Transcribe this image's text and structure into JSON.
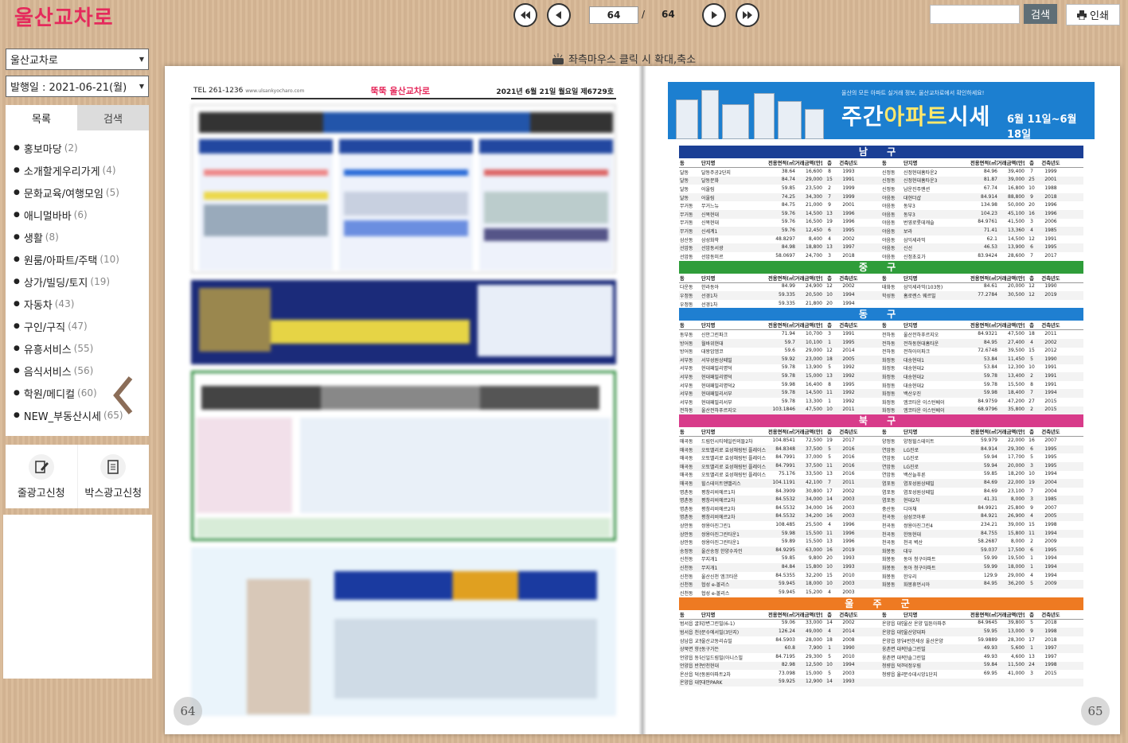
{
  "header": {
    "logo_part1": "울산",
    "logo_part2": "교차로",
    "current_page": "64",
    "page_separator": "/",
    "total_pages": "64",
    "search_placeholder": "",
    "search_label": "검색",
    "print_label": "인쇄"
  },
  "sidebar": {
    "publication_select": "울산교차로",
    "date_select": "발행일 : 2021-06-21(월)",
    "tabs": [
      "목록",
      "검색"
    ],
    "categories": [
      {
        "label": "홍보마당",
        "count": "(2)"
      },
      {
        "label": "소개할게우리가게",
        "count": "(4)"
      },
      {
        "label": "문화교육/여행모임",
        "count": "(5)"
      },
      {
        "label": "애니멀바바",
        "count": "(6)"
      },
      {
        "label": "생활",
        "count": "(8)"
      },
      {
        "label": "원룸/아파트/주택",
        "count": "(10)"
      },
      {
        "label": "상가/빌딩/토지",
        "count": "(19)"
      },
      {
        "label": "자동차",
        "count": "(43)"
      },
      {
        "label": "구인/구직",
        "count": "(47)"
      },
      {
        "label": "유흥서비스",
        "count": "(55)"
      },
      {
        "label": "음식서비스",
        "count": "(56)"
      },
      {
        "label": "학원/메디컬",
        "count": "(60)"
      },
      {
        "label": "NEW_부동산시세",
        "count": "(65)"
      }
    ],
    "ad_buttons": [
      "줄광고신청",
      "박스광고신청"
    ]
  },
  "viewer": {
    "hint": "좌측마우스 클릭 시 확대,축소",
    "left_page_number": "64",
    "right_page_number": "65",
    "left_page": {
      "tel": "TEL 261-1236",
      "site": "www.ulsankyocharo.com",
      "paper_name": "뚝뚝 울산교차로",
      "issue": "2021년 6월 21일 월요일 제6729호"
    },
    "right_page": {
      "banner_subtitle": "울산의 모든 아파트 실거래 정보, 울산교차로에서 확인하세요!",
      "banner_title_1": "주간",
      "banner_title_2": "아파트",
      "banner_title_3": "시세",
      "banner_dates": "6월 11일~6월 18일",
      "column_headers": [
        "동",
        "단지명",
        "전용면적(㎡)",
        "거래금액(만원)",
        "층",
        "건축년도"
      ],
      "sections": [
        {
          "name": "남 구",
          "color": "#1b3f95",
          "rows": [
            [
              "달동",
              "달동주공2단지",
              "38.64",
              "16,600",
              "8",
              "1993",
              "신정동",
              "신정현대홈타운2",
              "84.96",
              "39,400",
              "7",
              "1999"
            ],
            [
              "달동",
              "달동문화",
              "84.74",
              "29,000",
              "15",
              "1991",
              "신정동",
              "신정현대홈타운3",
              "81.87",
              "39,000",
              "25",
              "2001"
            ],
            [
              "달동",
              "어울림",
              "59.85",
              "23,500",
              "2",
              "1999",
              "신정동",
              "남운진주맨션",
              "67.74",
              "16,800",
              "10",
              "1988"
            ],
            [
              "달동",
              "어울림",
              "74.25",
              "34,300",
              "7",
              "1999",
              "야음동",
              "대현더샵",
              "84.914",
              "88,800",
              "9",
              "2018"
            ],
            [
              "무거동",
              "무거느뉴",
              "84.75",
              "21,000",
              "9",
              "2001",
              "야음동",
              "동부3",
              "134.98",
              "50,000",
              "20",
              "1996"
            ],
            [
              "무거동",
              "신복현대",
              "59.76",
              "14,500",
              "13",
              "1996",
              "야음동",
              "동부3",
              "104.23",
              "45,100",
              "16",
              "1996"
            ],
            [
              "무거동",
              "신복현대",
              "59.76",
              "16,500",
              "19",
              "1996",
              "야음동",
              "번영로롯데캐슬",
              "84.9761",
              "41,500",
              "3",
              "2006"
            ],
            [
              "무거동",
              "신세계1",
              "59.76",
              "12,450",
              "6",
              "1995",
              "야음동",
              "보라",
              "71.41",
              "13,360",
              "4",
              "1985"
            ],
            [
              "삼산동",
              "삼성화학",
              "48.8297",
              "8,400",
              "4",
              "2002",
              "야음동",
              "삼익세라믹",
              "62.1",
              "14,500",
              "12",
              "1991"
            ],
            [
              "선암동",
              "선암동서광",
              "84.98",
              "18,800",
              "13",
              "1997",
              "야음동",
              "신선",
              "46.53",
              "13,900",
              "6",
              "1995"
            ],
            [
              "선암동",
              "선암동미르",
              "58.0697",
              "24,700",
              "3",
              "2018",
              "야음동",
              "신정초호가",
              "83.9424",
              "28,600",
              "7",
              "2017"
            ]
          ]
        },
        {
          "name": "중 구",
          "color": "#2f9d3a",
          "rows": [
            [
              "다운동",
              "한라동아",
              "84.99",
              "24,900",
              "12",
              "2002",
              "태화동",
              "삼익세라믹(103동)",
              "84.61",
              "20,000",
              "12",
              "1990"
            ],
            [
              "우정동",
              "선경1차",
              "59.335",
              "20,500",
              "10",
              "1994",
              "학성동",
              "홈로렌스 웨르빌",
              "77.2784",
              "30,500",
              "12",
              "2019"
            ],
            [
              "우정동",
              "선경1차",
              "59.335",
              "21,800",
              "20",
              "1994",
              "",
              "",
              "",
              "",
              "",
              ""
            ]
          ]
        },
        {
          "name": "동 구",
          "color": "#1f7fd1",
          "rows": [
            [
              "동부동",
              "신안그린파크",
              "71.94",
              "10,700",
              "3",
              "1991",
              "전하동",
              "울산전하푸르지오",
              "84.9321",
              "47,500",
              "18",
              "2011"
            ],
            [
              "방어동",
              "월바위현대",
              "59.7",
              "10,100",
              "1",
              "1995",
              "전하동",
              "전하동현대홈타운",
              "84.95",
              "27,400",
              "4",
              "2002"
            ],
            [
              "방어동",
              "대왕암엠코",
              "59.6",
              "29,000",
              "12",
              "2014",
              "전하동",
              "전하아이파크",
              "72.6748",
              "39,500",
              "15",
              "2012"
            ],
            [
              "서부동",
              "서부성원상떼빌",
              "59.92",
              "23,000",
              "18",
              "2005",
              "화정동",
              "대송현대1",
              "53.84",
              "11,450",
              "5",
              "1990"
            ],
            [
              "서부동",
              "현대패밀리명덕",
              "59.78",
              "13,900",
              "5",
              "1992",
              "화정동",
              "대송현대2",
              "53.84",
              "12,300",
              "10",
              "1991"
            ],
            [
              "서부동",
              "현대패밀리명덕",
              "59.78",
              "15,000",
              "13",
              "1992",
              "화정동",
              "대송현대2",
              "59.78",
              "13,400",
              "2",
              "1991"
            ],
            [
              "서부동",
              "현대패밀리명덕2",
              "59.98",
              "16,400",
              "8",
              "1995",
              "화정동",
              "대송현대2",
              "59.78",
              "15,500",
              "8",
              "1991"
            ],
            [
              "서부동",
              "현대패밀리서부",
              "59.78",
              "14,500",
              "11",
              "1992",
              "화정동",
              "백산우진",
              "59.98",
              "18,400",
              "7",
              "1994"
            ],
            [
              "서부동",
              "현대패밀리서부",
              "59.78",
              "13,300",
              "1",
              "1992",
              "화정동",
              "엠코타운 이스턴베이",
              "84.9759",
              "47,200",
              "27",
              "2015"
            ],
            [
              "전하동",
              "울산전하푸르지오",
              "103.1846",
              "47,500",
              "10",
              "2011",
              "화정동",
              "엠코타운 이스턴베이",
              "68.9796",
              "35,800",
              "2",
              "2015"
            ]
          ]
        },
        {
          "name": "북 구",
          "color": "#d83b8a",
          "rows": [
            [
              "매곡동",
              "드림인시티에일린의뜰2차",
              "104.8541",
              "72,500",
              "19",
              "2017",
              "양정동",
              "양정힐스테이트",
              "59.979",
              "22,000",
              "16",
              "2007"
            ],
            [
              "매곡동",
              "오토밸리로 효성해링턴 플레이스",
              "84.8348",
              "37,500",
              "5",
              "2016",
              "연암동",
              "LG진로",
              "84.914",
              "29,300",
              "6",
              "1995"
            ],
            [
              "매곡동",
              "오토밸리로 효성해링턴 플레이스",
              "84.7991",
              "37,000",
              "5",
              "2016",
              "연암동",
              "LG진로",
              "59.94",
              "17,700",
              "5",
              "1995"
            ],
            [
              "매곡동",
              "오토밸리로 효성해링턴 플레이스",
              "84.7991",
              "37,500",
              "11",
              "2016",
              "연암동",
              "LG진로",
              "59.94",
              "20,000",
              "3",
              "1995"
            ],
            [
              "매곡동",
              "오토밸리로 효성해링턴 플레이스",
              "75.176",
              "33,500",
              "13",
              "2016",
              "연암동",
              "백산늘푸른",
              "59.85",
              "18,200",
              "10",
              "1994"
            ],
            [
              "매곡동",
              "힐스테이트앤밸리스",
              "104.1191",
              "42,100",
              "7",
              "2011",
              "염포동",
              "염포성원상떼빌",
              "84.69",
              "22,000",
              "19",
              "2004"
            ],
            [
              "명촌동",
              "평창리비에르1차",
              "84.3909",
              "30,800",
              "17",
              "2002",
              "염포동",
              "염포성원상떼빌",
              "84.69",
              "23,100",
              "7",
              "2004"
            ],
            [
              "명촌동",
              "평창리비에르2차",
              "84.5532",
              "34,000",
              "14",
              "2003",
              "염포동",
              "현대2차",
              "41.31",
              "8,000",
              "3",
              "1985"
            ],
            [
              "명촌동",
              "평창리비에르2차",
              "84.5532",
              "34,000",
              "16",
              "2003",
              "중산동",
              "디아채",
              "84.9921",
              "25,800",
              "9",
              "2007"
            ],
            [
              "명촌동",
              "평창리비에르2차",
              "84.5532",
              "34,200",
              "16",
              "2003",
              "천곡동",
              "삼성코아루",
              "84.921",
              "26,900",
              "4",
              "2005"
            ],
            [
              "상안동",
              "쌍용아진그린1",
              "108.485",
              "25,500",
              "4",
              "1996",
              "천곡동",
              "쌍용아진그린4",
              "234.21",
              "39,000",
              "15",
              "1998"
            ],
            [
              "상안동",
              "쌍용아진그린타운1",
              "59.98",
              "15,500",
              "11",
              "1996",
              "천곡동",
              "한동현대",
              "84.755",
              "15,800",
              "11",
              "1994"
            ],
            [
              "상안동",
              "쌍용아진그린타운1",
              "59.89",
              "15,500",
              "13",
              "1996",
              "천곡동",
              "천곡 벽산",
              "58.2687",
              "8,000",
              "2",
              "2009"
            ],
            [
              "송정동",
              "울산송정 한양수자인",
              "84.9295",
              "63,000",
              "16",
              "2019",
              "화봉동",
              "대우",
              "59.037",
              "17,500",
              "6",
              "1995"
            ],
            [
              "신천동",
              "무지개1",
              "59.85",
              "9,800",
              "20",
              "1993",
              "화봉동",
              "동아 청구아파트",
              "59.99",
              "19,500",
              "1",
              "1994"
            ],
            [
              "신천동",
              "무지개1",
              "84.84",
              "15,800",
              "10",
              "1993",
              "화봉동",
              "동아 청구아파트",
              "59.99",
              "18,000",
              "1",
              "1994"
            ],
            [
              "신천동",
              "울산신천 엠크타운",
              "84.5355",
              "32,200",
              "15",
              "2010",
              "화봉동",
              "한우리",
              "129.9",
              "29,000",
              "4",
              "1994"
            ],
            [
              "신천동",
              "협성 e-볼리스",
              "59.945",
              "18,000",
              "10",
              "2003",
              "화봉동",
              "화봉휴먼시아",
              "84.95",
              "36,200",
              "5",
              "2009"
            ],
            [
              "신천동",
              "협성 e-볼리스",
              "59.945",
              "15,200",
              "4",
              "2003",
              "",
              "",
              "",
              "",
              "",
              ""
            ]
          ]
        },
        {
          "name": "울 주 군",
          "color": "#ee7a22",
          "rows": [
            [
              "범서읍 굴화리",
              "강변그린빌(6-1)",
              "59.06",
              "33,000",
              "14",
              "2002",
              "온양읍 대안리",
              "울산 온양 밀튼아파주",
              "84.9645",
              "39,800",
              "5",
              "2018"
            ],
            [
              "범서읍 천상리",
              "문수에서빌(3단지)",
              "126.24",
              "49,000",
              "4",
              "2014",
              "온양읍 대안리",
              "울산양대파",
              "59.95",
              "13,000",
              "9",
              "1998"
            ],
            [
              "삼남읍 교동리",
              "울산교동리슈빌",
              "84.5903",
              "28,000",
              "18",
              "2008",
              "온양읍 망양리",
              "4번한세상 울산온양",
              "59.9889",
              "28,300",
              "17",
              "2018"
            ],
            [
              "상북면 향산리",
              "동구가든",
              "60.8",
              "7,900",
              "1",
              "1990",
              "웅촌면 대복리",
              "한솔그린빌",
              "49.93",
              "5,600",
              "1",
              "1997"
            ],
            [
              "언양읍 동부리",
              "신일드림빌(아니스빌",
              "84.7195",
              "29,300",
              "5",
              "2010",
              "웅촌면 대복리",
              "한솔그린빌",
              "49.93",
              "4,600",
              "13",
              "1997"
            ],
            [
              "언양읍 반천리",
              "반천현대",
              "82.98",
              "12,500",
              "10",
              "1994",
              "청량읍 덕하리",
              "덕정우림",
              "59.84",
              "11,500",
              "24",
              "1998"
            ],
            [
              "온산읍 덕신리",
              "동원아파트2차",
              "73.098",
              "15,000",
              "5",
              "2003",
              "청량읍 율리",
              "문수데시앙1단지",
              "69.95",
              "41,000",
              "3",
              "2015"
            ],
            [
              "온양읍 대안리",
              "대안PARK",
              "59.925",
              "12,900",
              "14",
              "1993",
              "",
              "",
              "",
              "",
              "",
              ""
            ]
          ]
        }
      ]
    }
  },
  "colors": {
    "brand": "#e52a5c",
    "search_button": "#5f6e76"
  }
}
